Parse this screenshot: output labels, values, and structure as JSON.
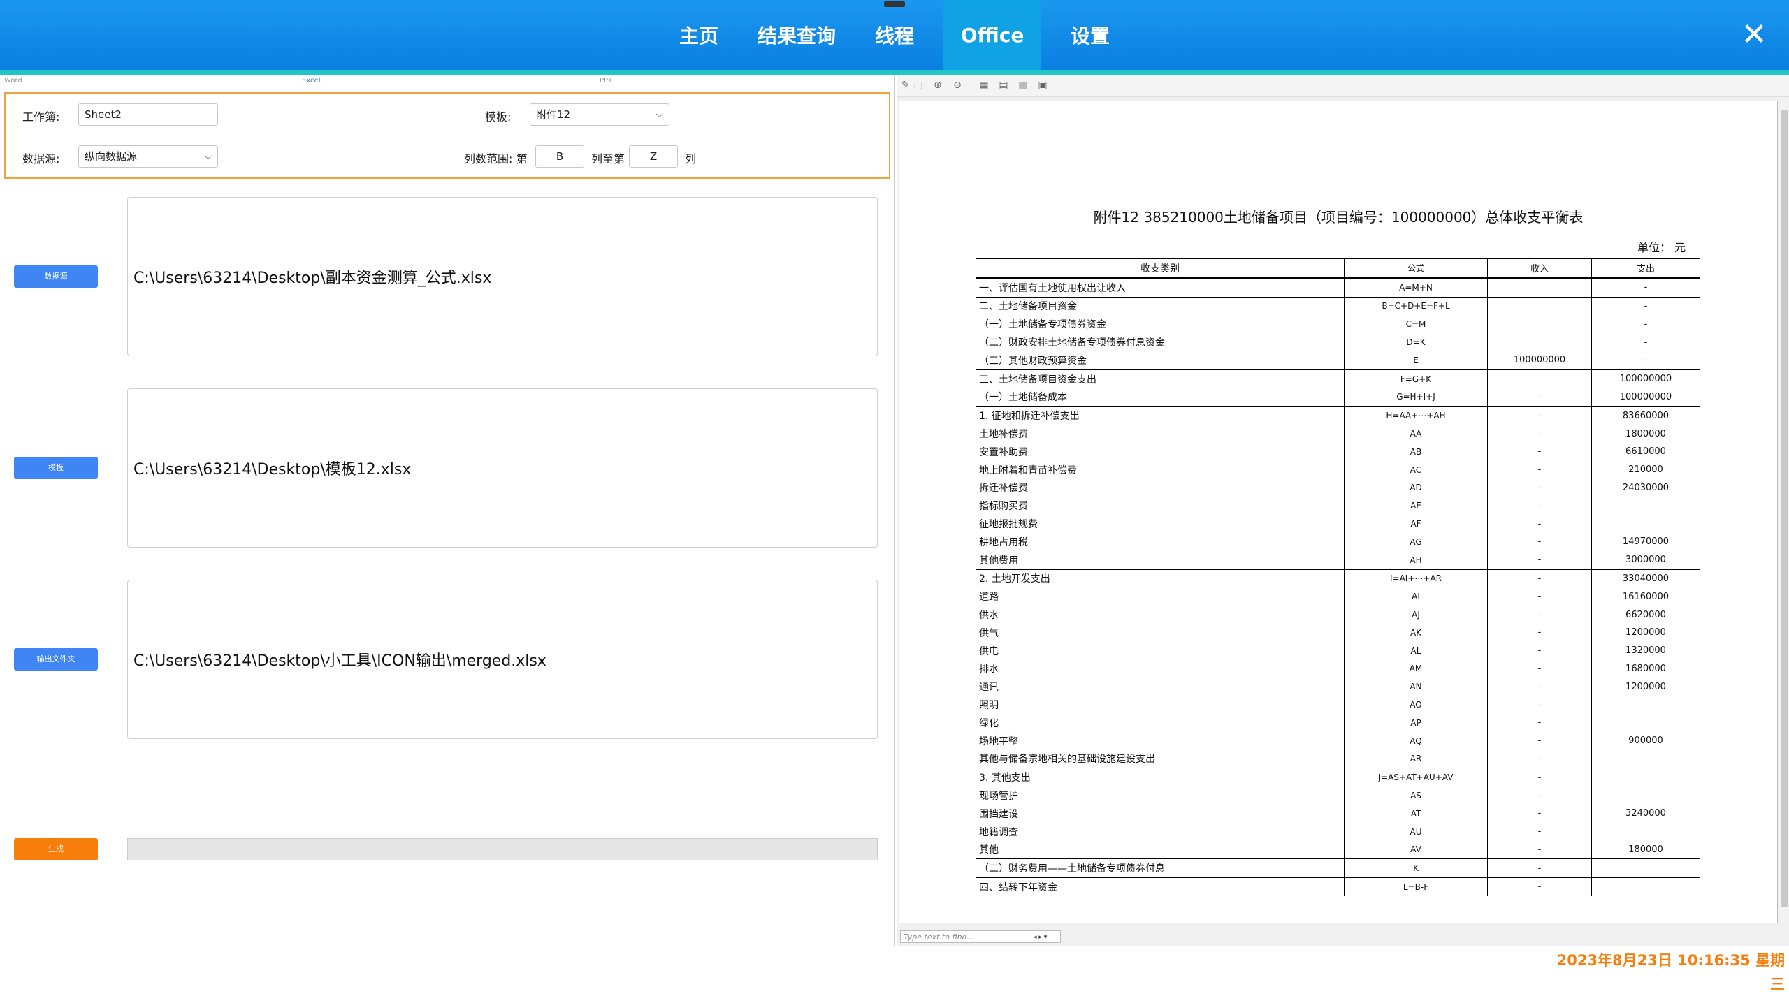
{
  "nav": {
    "items": [
      "主页",
      "结果查询",
      "线程",
      "Office",
      "设置"
    ],
    "active": "Office"
  },
  "office_tabs": [
    "Word",
    "Excel",
    "PPT"
  ],
  "form": {
    "workbook_label": "工作簿:",
    "workbook_value": "Sheet2",
    "template_label": "模板:",
    "template_value": "附件12",
    "datasource_label": "数据源:",
    "datasource_value": "纵向数据源",
    "col_range_label": "列数范围: 第",
    "col_from": "B",
    "col_to_label": "列至第",
    "col_to": "Z",
    "col_suffix": "列"
  },
  "buttons": {
    "datasource": "数据源",
    "template": "模板",
    "output_folder": "输出文件夹",
    "generate": "生成"
  },
  "paths": {
    "datasource": "C:\\Users\\63214\\Desktop\\副本资金测算_公式.xlsx",
    "template": "C:\\Users\\63214\\Desktop\\模板12.xlsx",
    "output": "C:\\Users\\63214\\Desktop\\小工具\\ICON输出\\merged.xlsx"
  },
  "progress": 0,
  "preview": {
    "title": "附件12 385210000土地储备项目（项目编号：100000000）总体收支平衡表",
    "unit": "单位： 元",
    "headers": [
      "收支类别",
      "公式",
      "收入",
      "支出"
    ],
    "rows": [
      [
        "一、评估国有土地使用权出让收入",
        "A=M+N",
        "",
        "-"
      ],
      [
        "二、土地储备项目资金",
        "B=C+D+E=F+L",
        "",
        "-"
      ],
      [
        "（一）土地储备专项债券资金",
        "C=M",
        "",
        "-"
      ],
      [
        "（二）财政安排土地储备专项债券付息资金",
        "D=K",
        "",
        "-"
      ],
      [
        "（三）其他财政预算资金",
        "E",
        "100000000",
        "-"
      ],
      [
        "三、土地储备项目资金支出",
        "F=G+K",
        "",
        "100000000"
      ],
      [
        "（一）土地储备成本",
        "G=H+I+J",
        "-",
        "100000000"
      ],
      [
        "1. 征地和拆迁补偿支出",
        "H=AA+⋯+AH",
        "-",
        "83660000"
      ],
      [
        "土地补偿费",
        "AA",
        "-",
        "1800000"
      ],
      [
        "安置补助费",
        "AB",
        "-",
        "6610000"
      ],
      [
        "地上附着和青苗补偿费",
        "AC",
        "-",
        "210000"
      ],
      [
        "拆迁补偿费",
        "AD",
        "-",
        "24030000"
      ],
      [
        "指标购买费",
        "AE",
        "-",
        ""
      ],
      [
        "征地报批规费",
        "AF",
        "-",
        ""
      ],
      [
        "耕地占用税",
        "AG",
        "-",
        "14970000"
      ],
      [
        "其他费用",
        "AH",
        "-",
        "3000000"
      ],
      [
        "2. 土地开发支出",
        "I=AI+⋯+AR",
        "-",
        "33040000"
      ],
      [
        "道路",
        "AI",
        "-",
        "16160000"
      ],
      [
        "供水",
        "AJ",
        "-",
        "6620000"
      ],
      [
        "供气",
        "AK",
        "-",
        "1200000"
      ],
      [
        "供电",
        "AL",
        "-",
        "1320000"
      ],
      [
        "排水",
        "AM",
        "-",
        "1680000"
      ],
      [
        "通讯",
        "AN",
        "-",
        "1200000"
      ],
      [
        "照明",
        "AO",
        "-",
        ""
      ],
      [
        "绿化",
        "AP",
        "-",
        ""
      ],
      [
        "场地平整",
        "AQ",
        "-",
        "900000"
      ],
      [
        "其他与储备宗地相关的基础设施建设支出",
        "AR",
        "-",
        ""
      ],
      [
        "3. 其他支出",
        "J=AS+AT+AU+AV",
        "-",
        ""
      ],
      [
        "现场管护",
        "AS",
        "-",
        ""
      ],
      [
        "围挡建设",
        "AT",
        "-",
        "3240000"
      ],
      [
        "地籍调查",
        "AU",
        "-",
        ""
      ],
      [
        "其他",
        "AV",
        "-",
        "180000"
      ],
      [
        "（二）财务费用——土地储备专项债券付息",
        "K",
        "-",
        ""
      ],
      [
        "四、结转下年资金",
        "L=B-F",
        "-",
        ""
      ]
    ],
    "find_placeholder": "Type text to find..."
  },
  "datetime": "2023年8月23日 10:16:35 星期三",
  "colors": {
    "nav_bg": "#0a7fe0",
    "accent_teal": "#22c6c8",
    "button_blue": "#3f86f4",
    "button_orange": "#f97d0b",
    "form_border": "#f2a23a"
  }
}
